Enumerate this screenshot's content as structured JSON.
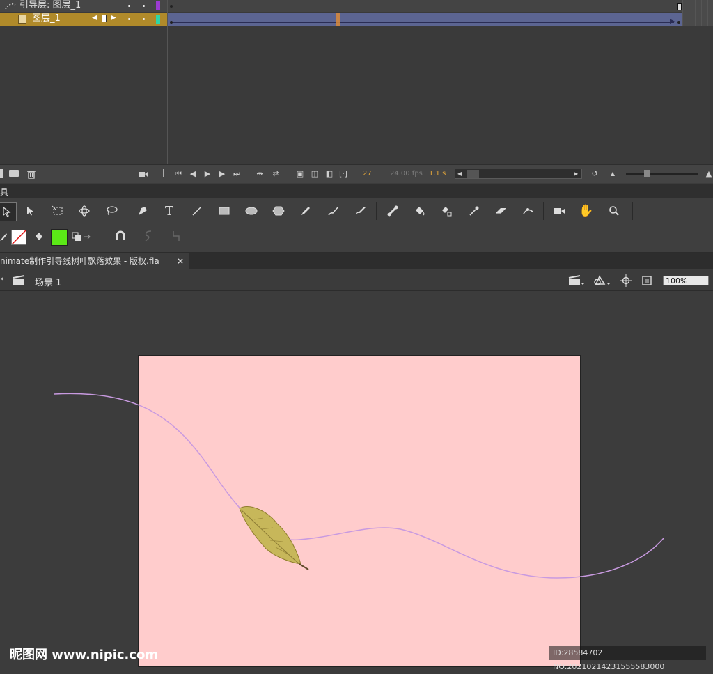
{
  "timeline": {
    "guide_layer_label": "引导层: 图层_1",
    "layer_label": "图层_1",
    "current_frame": "27",
    "fps": "24.00 fps",
    "elapsed": "1.1 s",
    "colors": {
      "guide_swatch": "#9c3bd1",
      "layer_swatch": "#2fd6a6",
      "selected_row": "#b08a2a",
      "tween_span": "#5c6592",
      "playhead": "#b42424"
    }
  },
  "tools": {
    "header_label": "具",
    "text_tool_glyph": "T",
    "fill_color": "#5be817",
    "stroke_color": "none"
  },
  "document": {
    "tab_title": "nimate制作引导线树叶飘落效果 - 版权.fla",
    "tab_close": "×",
    "scene_label": "场景 1",
    "zoom": "100%"
  },
  "stage": {
    "background": "#ffcccc",
    "pasteboard": "#3c3c3c",
    "guide_path_color": "#c89ae0"
  },
  "watermark": {
    "left": "昵图网 www.nipic.com",
    "right": "ID:28584702 NO:20210214231555583000"
  }
}
